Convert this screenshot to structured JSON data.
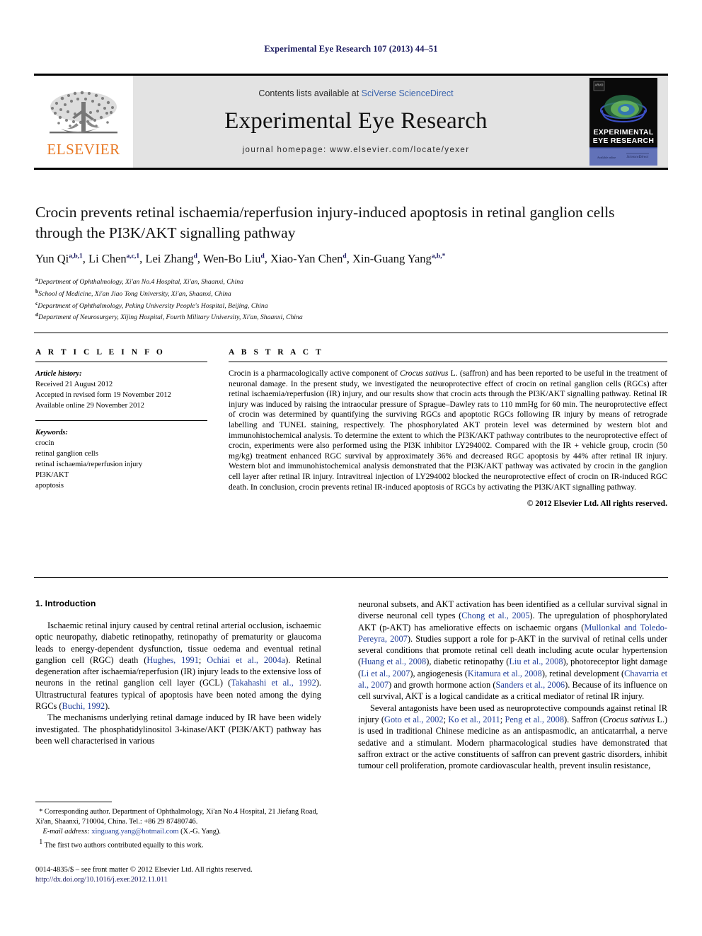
{
  "running_head": "Experimental Eye Research 107 (2013) 44–51",
  "masthead": {
    "publisher_logo_text": "ELSEVIER",
    "contents_prefix": "Contents lists available at ",
    "contents_link": "SciVerse ScienceDirect",
    "journal_name": "Experimental Eye Research",
    "homepage": "journal homepage: www.elsevier.com/locate/yexer",
    "cover": {
      "title_line1": "EXPERIMENTAL",
      "title_line2": "EYE RESEARCH",
      "badge": "ARVO"
    }
  },
  "article": {
    "title": "Crocin prevents retinal ischaemia/reperfusion injury-induced apoptosis in retinal ganglion cells through the PI3K/AKT signalling pathway",
    "authors": [
      {
        "name": "Yun Qi",
        "sup": "a,b,1"
      },
      {
        "name": "Li Chen",
        "sup": "a,c,1"
      },
      {
        "name": "Lei Zhang",
        "sup": "d"
      },
      {
        "name": "Wen-Bo Liu",
        "sup": "d"
      },
      {
        "name": "Xiao-Yan Chen",
        "sup": "d"
      },
      {
        "name": "Xin-Guang Yang",
        "sup": "a,b,*"
      }
    ],
    "affiliations": [
      {
        "mark": "a",
        "text": "Department of Ophthalmology, Xi'an No.4 Hospital, Xi'an, Shaanxi, China"
      },
      {
        "mark": "b",
        "text": "School of Medicine, Xi'an Jiao Tong University, Xi'an, Shaanxi, China"
      },
      {
        "mark": "c",
        "text": "Department of Ophthalmology, Peking University People's Hospital, Beijing, China"
      },
      {
        "mark": "d",
        "text": "Department of Neurosurgery, Xijing Hospital, Fourth Military University, Xi'an, Shaanxi, China"
      }
    ]
  },
  "article_info": {
    "heading": "A R T I C L E   I N F O",
    "history_label": "Article history:",
    "history": [
      "Received 21 August 2012",
      "Accepted in revised form 19 November 2012",
      "Available online 29 November 2012"
    ],
    "keywords_label": "Keywords:",
    "keywords": [
      "crocin",
      "retinal ganglion cells",
      "retinal ischaemia/reperfusion injury",
      "PI3K/AKT",
      "apoptosis"
    ]
  },
  "abstract": {
    "heading": "A B S T R A C T",
    "text_part1": "Crocin is a pharmacologically active component of ",
    "species": "Crocus sativus",
    "text_part2": " L. (saffron) and has been reported to be useful in the treatment of neuronal damage. In the present study, we investigated the neuroprotective effect of crocin on retinal ganglion cells (RGCs) after retinal ischaemia/reperfusion (IR) injury, and our results show that crocin acts through the PI3K/AKT signalling pathway. Retinal IR injury was induced by raising the intraocular pressure of Sprague–Dawley rats to 110 mmHg for 60 min. The neuroprotective effect of crocin was determined by quantifying the surviving RGCs and apoptotic RGCs following IR injury by means of retrograde labelling and TUNEL staining, respectively. The phosphorylated AKT protein level was determined by western blot and immunohistochemical analysis. To determine the extent to which the PI3K/AKT pathway contributes to the neuroprotective effect of crocin, experiments were also performed using the PI3K inhibitor LY294002. Compared with the IR + vehicle group, crocin (50 mg/kg) treatment enhanced RGC survival by approximately 36% and decreased RGC apoptosis by 44% after retinal IR injury. Western blot and immunohistochemical analysis demonstrated that the PI3K/AKT pathway was activated by crocin in the ganglion cell layer after retinal IR injury. Intravitreal injection of LY294002 blocked the neuroprotective effect of crocin on IR-induced RGC death. In conclusion, crocin prevents retinal IR-induced apoptosis of RGCs by activating the PI3K/AKT signalling pathway.",
    "copyright": "© 2012 Elsevier Ltd. All rights reserved."
  },
  "introduction": {
    "heading": "1. Introduction",
    "left_p1_a": "Ischaemic retinal injury caused by central retinal arterial occlusion, ischaemic optic neuropathy, diabetic retinopathy, retinopathy of prematurity or glaucoma leads to energy-dependent dysfunction, tissue oedema and eventual retinal ganglion cell (RGC) death (",
    "ref_hughes": "Hughes, 1991",
    "left_p1_b": "; ",
    "ref_ochiai": "Ochiai et al., 2004a",
    "left_p1_c": "). Retinal degeneration after ischaemia/reperfusion (IR) injury leads to the extensive loss of neurons in the retinal ganglion cell layer (GCL) (",
    "ref_takahashi": "Takahashi et al., 1992",
    "left_p1_d": "). Ultrastructural features typical of apoptosis have been noted among the dying RGCs (",
    "ref_buchi": "Buchi, 1992",
    "left_p1_e": ").",
    "left_p2": "The mechanisms underlying retinal damage induced by IR have been widely investigated. The phosphatidylinositol 3-kinase/AKT (PI3K/AKT) pathway has been well characterised in various",
    "right_p1_a": "neuronal subsets, and AKT activation has been identified as a cellular survival signal in diverse neuronal cell types (",
    "ref_chong": "Chong et al., 2005",
    "right_p1_b": "). The upregulation of phosphorylated AKT (p-AKT) has ameliorative effects on ischaemic organs (",
    "ref_mullonkal": "Mullonkal and Toledo-Pereyra, 2007",
    "right_p1_c": "). Studies support a role for p-AKT in the survival of retinal cells under several conditions that promote retinal cell death including acute ocular hypertension (",
    "ref_huang": "Huang et al., 2008",
    "right_p1_d": "), diabetic retinopathy (",
    "ref_liu": "Liu et al., 2008",
    "right_p1_e": "), photoreceptor light damage (",
    "ref_li": "Li et al., 2007",
    "right_p1_f": "), angiogenesis (",
    "ref_kitamura": "Kitamura et al., 2008",
    "right_p1_g": "), retinal development (",
    "ref_chavarria": "Chavarria et al., 2007",
    "right_p1_h": ") and growth hormone action (",
    "ref_sanders": "Sanders et al., 2006",
    "right_p1_i": "). Because of its influence on cell survival, AKT is a logical candidate as a critical mediator of retinal IR injury.",
    "right_p2_a": "Several antagonists have been used as neuroprotective compounds against retinal IR injury (",
    "ref_goto": "Goto et al., 2002",
    "right_p2_b": "; ",
    "ref_ko": "Ko et al., 2011",
    "right_p2_c": "; ",
    "ref_peng": "Peng et al., 2008",
    "right_p2_d": "). Saffron (",
    "species2": "Crocus sativus",
    "right_p2_e": " L.) is used in traditional Chinese medicine as an antispasmodic, an anticatarrhal, a nerve sedative and a stimulant. Modern pharmacological studies have demonstrated that saffron extract or the active constituents of saffron can prevent gastric disorders, inhibit tumour cell proliferation, promote cardiovascular health, prevent insulin resistance,"
  },
  "footnotes": {
    "corresponding_mark": "*",
    "corresponding": " Corresponding author. Department of Ophthalmology, Xi'an No.4 Hospital, 21 Jiefang Road, Xi'an, Shaanxi, 710004, China. Tel.: +86 29 87480746.",
    "email_label": "E-mail address:",
    "email": "xinguang.yang@hotmail.com",
    "email_suffix": " (X.-G. Yang).",
    "equal_mark": "1",
    "equal_contrib": " The first two authors contributed equally to this work."
  },
  "imprint": {
    "issn_line": "0014-4835/$ – see front matter © 2012 Elsevier Ltd. All rights reserved.",
    "doi": "http://dx.doi.org/10.1016/j.exer.2012.11.011"
  },
  "colors": {
    "elsevier_orange": "#e87722",
    "link_blue": "#1f3d99",
    "runhead_navy": "#1a1a5e",
    "banner_gray": "#e3e3e3"
  }
}
